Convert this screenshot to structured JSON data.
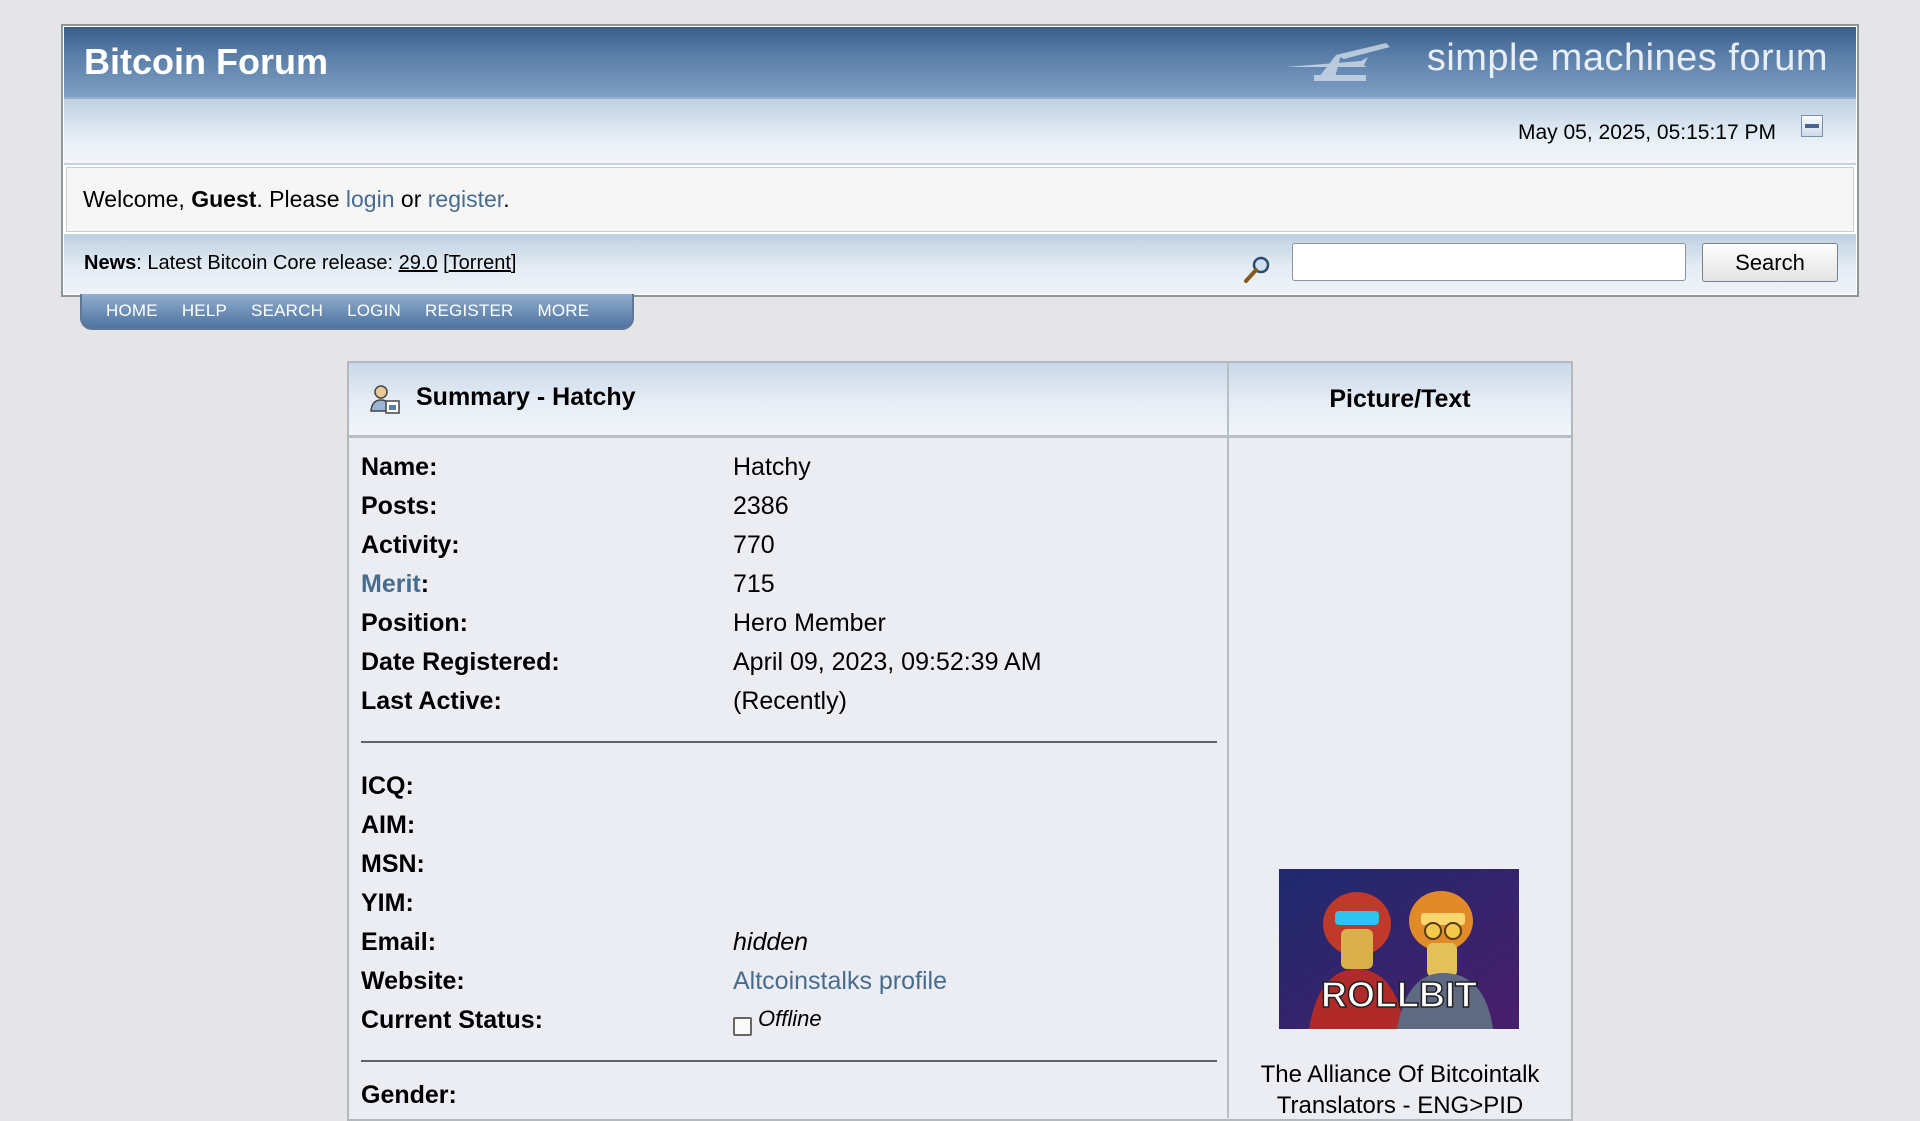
{
  "header": {
    "forum_title": "Bitcoin Forum",
    "logo_text": "simple machines forum",
    "datetime": "May 05, 2025, 05:15:17 PM"
  },
  "welcome": {
    "prefix": "Welcome, ",
    "user": "Guest",
    "please": ". Please ",
    "login": "login",
    "or": " or ",
    "register": "register",
    "end": "."
  },
  "news": {
    "label": "News",
    "text": ": Latest Bitcoin Core release: ",
    "version": "29.0",
    "torrent_open": " [",
    "torrent": "Torrent",
    "torrent_close": "]"
  },
  "search": {
    "button_label": "Search",
    "input_value": ""
  },
  "menu": [
    "HOME",
    "HELP",
    "SEARCH",
    "LOGIN",
    "REGISTER",
    "MORE"
  ],
  "profile": {
    "summary_title": "Summary - Hatchy",
    "picture_header": "Picture/Text",
    "fields": [
      {
        "label": "Name:",
        "value": "Hatchy"
      },
      {
        "label": "Posts:",
        "value": "2386"
      },
      {
        "label": "Activity:",
        "value": "770"
      },
      {
        "label": "Merit",
        "value": "715"
      },
      {
        "label": "Position:",
        "value": "Hero Member"
      },
      {
        "label": "Date Registered:",
        "value": "April 09, 2023, 09:52:39 AM"
      },
      {
        "label": "Last Active:",
        "value": "(Recently)"
      }
    ],
    "contacts": [
      {
        "label": "ICQ:",
        "value": ""
      },
      {
        "label": "AIM:",
        "value": ""
      },
      {
        "label": "MSN:",
        "value": ""
      },
      {
        "label": "YIM:",
        "value": ""
      },
      {
        "label": "Email:",
        "value": "hidden"
      },
      {
        "label": "Website:",
        "value": "Altcoinstalks profile"
      },
      {
        "label": "Current Status:",
        "value": "Offline"
      }
    ],
    "next_label": "Gender:",
    "avatar_text": "ROLLBIT",
    "personal_text_1": "The Alliance Of Bitcointalk",
    "personal_text_2": "Translators - ENG>PID"
  },
  "colors": {
    "link": "#476c8e",
    "header_blue": "#3a5f8a",
    "page_bg": "#e5e5e8"
  }
}
